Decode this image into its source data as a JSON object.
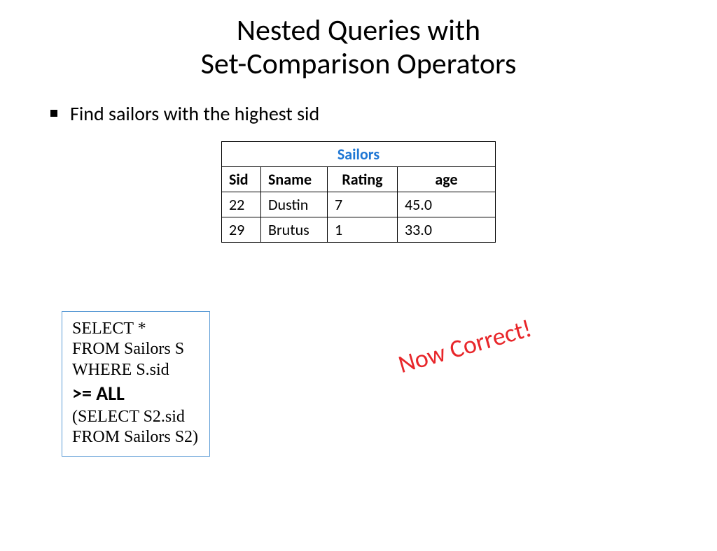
{
  "title_line1": "Nested Queries with",
  "title_line2": "Set-Comparison Operators",
  "bullet": "Find sailors with the highest sid",
  "table": {
    "caption": "Sailors",
    "headers": {
      "sid": "Sid",
      "sname": "Sname",
      "rating": "Rating",
      "age": "age"
    },
    "rows": [
      {
        "sid": "22",
        "sname": "Dustin",
        "rating": "7",
        "age": "45.0"
      },
      {
        "sid": "29",
        "sname": "Brutus",
        "rating": "1",
        "age": "33.0"
      }
    ]
  },
  "query": {
    "l1a": "SELECT",
    "l1b": "  *",
    "l2a": "FROM",
    "l2b": "  Sailors S",
    "l3a": "WHERE",
    "l3b": "  S.sid",
    "l4": ">= ALL",
    "l5a": "(SELECT",
    "l5b": "  S2.sid",
    "l6a": "FROM",
    "l6b": "  Sailors S2)"
  },
  "callout": "Now Correct!"
}
